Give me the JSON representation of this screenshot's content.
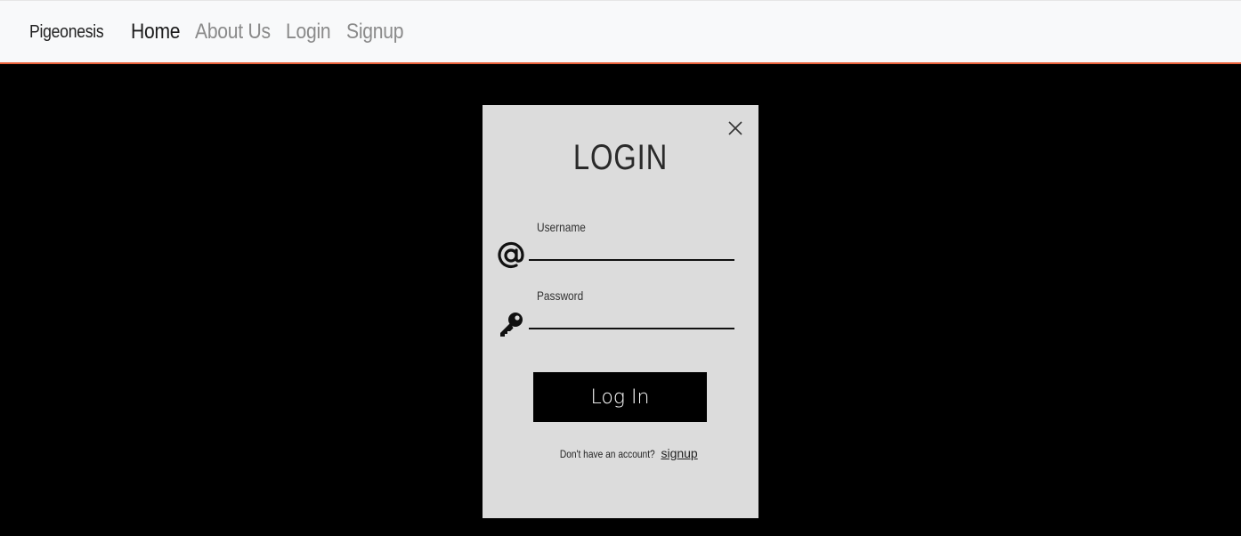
{
  "navbar": {
    "brand": "Pigeonesis",
    "links": [
      {
        "label": "Home",
        "active": true
      },
      {
        "label": "About Us",
        "active": false
      },
      {
        "label": "Login",
        "active": false
      },
      {
        "label": "Signup",
        "active": false
      }
    ],
    "accent_color": "#e8613a"
  },
  "modal": {
    "title": "LOGIN",
    "username_label": "Username",
    "username_value": "",
    "password_label": "Password",
    "password_value": "",
    "login_button": "Log In",
    "account_prompt": "Don't have an account?",
    "signup_link": "signup",
    "icons": {
      "close": "close-icon",
      "username": "at-sign-icon",
      "password": "key-icon"
    }
  }
}
